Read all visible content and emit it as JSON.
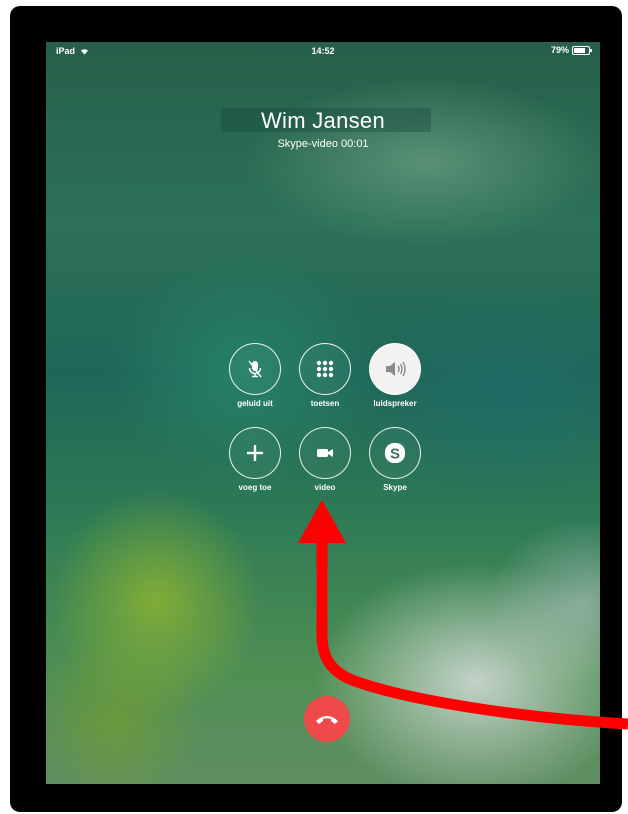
{
  "status_bar": {
    "device": "iPad",
    "wifi_icon": "wifi-icon",
    "time": "14:52",
    "battery_percent": "79%",
    "battery_level": 0.79
  },
  "call": {
    "caller_name": "Wim Jansen",
    "status": "Skype-video 00:01"
  },
  "controls": [
    {
      "label": "geluid uit",
      "icon": "microphone-mute-icon",
      "active": false
    },
    {
      "label": "toetsen",
      "icon": "keypad-icon",
      "active": false
    },
    {
      "label": "luidspreker",
      "icon": "speaker-icon",
      "active": true
    },
    {
      "label": "voeg toe",
      "icon": "plus-icon",
      "active": false
    },
    {
      "label": "video",
      "icon": "video-camera-icon",
      "active": false
    },
    {
      "label": "Skype",
      "icon": "skype-icon",
      "active": false
    }
  ],
  "end_call": {
    "icon": "phone-hangup-icon",
    "color": "#ee4a4a"
  },
  "annotation": {
    "icon": "red-arrow-icon",
    "color": "#ff0000"
  }
}
